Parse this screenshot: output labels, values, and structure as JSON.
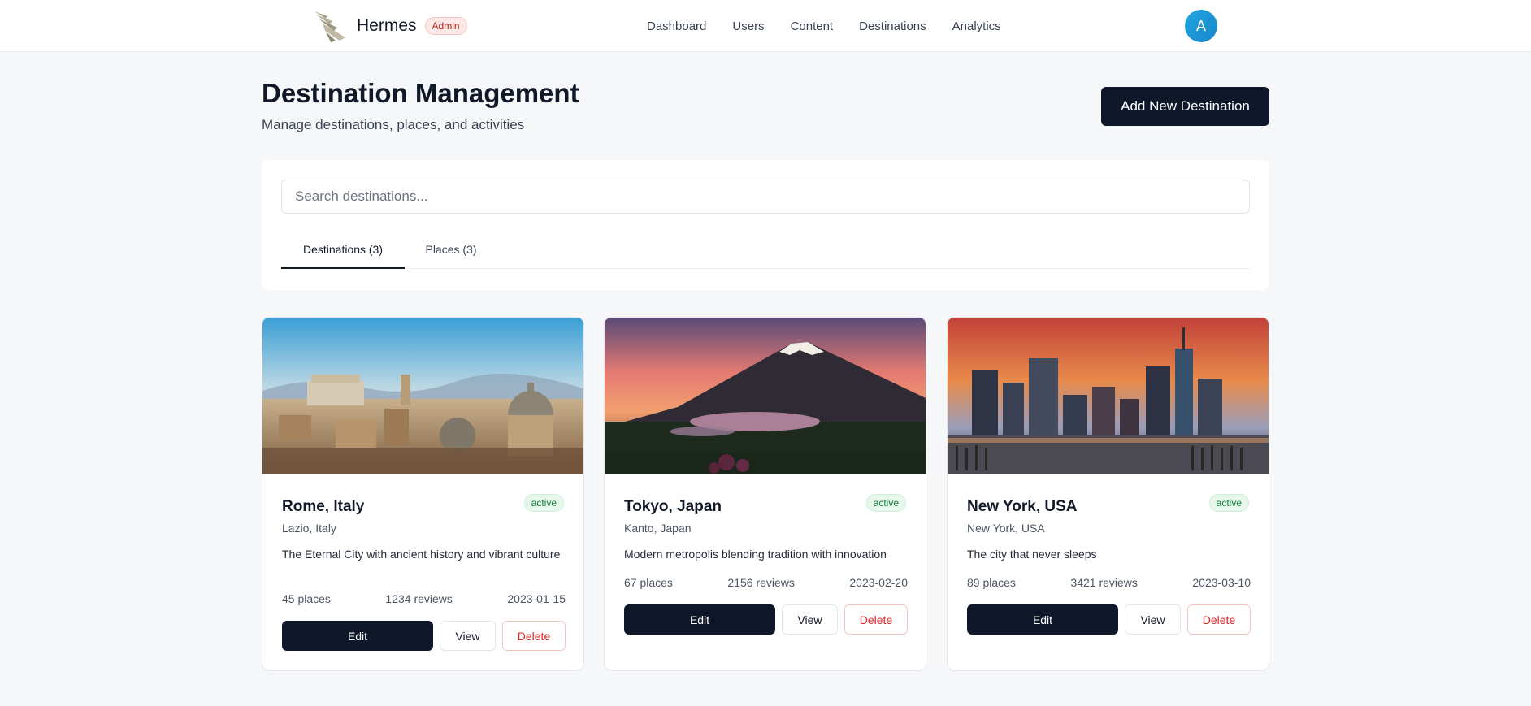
{
  "app": {
    "name": "Hermes",
    "badge": "Admin",
    "avatar_initial": "A",
    "nav": [
      "Dashboard",
      "Users",
      "Content",
      "Destinations",
      "Analytics"
    ]
  },
  "header": {
    "title": "Destination Management",
    "subtitle": "Manage destinations, places, and activities",
    "add_button": "Add New Destination"
  },
  "search": {
    "placeholder": "Search destinations...",
    "value": ""
  },
  "tabs": [
    {
      "label": "Destinations (3)",
      "active": true
    },
    {
      "label": "Places (3)",
      "active": false
    }
  ],
  "actions": {
    "edit": "Edit",
    "view": "View",
    "delete": "Delete"
  },
  "destinations": [
    {
      "name": "Rome, Italy",
      "region": "Lazio, Italy",
      "description": "The Eternal City with ancient history and vibrant culture",
      "places": "45 places",
      "reviews": "1234 reviews",
      "date": "2023-01-15",
      "status": "active",
      "image": "rome-skyline-photo"
    },
    {
      "name": "Tokyo, Japan",
      "region": "Kanto, Japan",
      "description": "Modern metropolis blending tradition with innovation",
      "places": "67 places",
      "reviews": "2156 reviews",
      "date": "2023-02-20",
      "status": "active",
      "image": "mount-fuji-photo"
    },
    {
      "name": "New York, USA",
      "region": "New York, USA",
      "description": "The city that never sleeps",
      "places": "89 places",
      "reviews": "3421 reviews",
      "date": "2023-03-10",
      "status": "active",
      "image": "new-york-skyline-photo"
    }
  ],
  "colors": {
    "primary": "#0f172a",
    "active_status": "#15803d",
    "danger": "#dc2626",
    "avatar": "#1ea7e0"
  }
}
